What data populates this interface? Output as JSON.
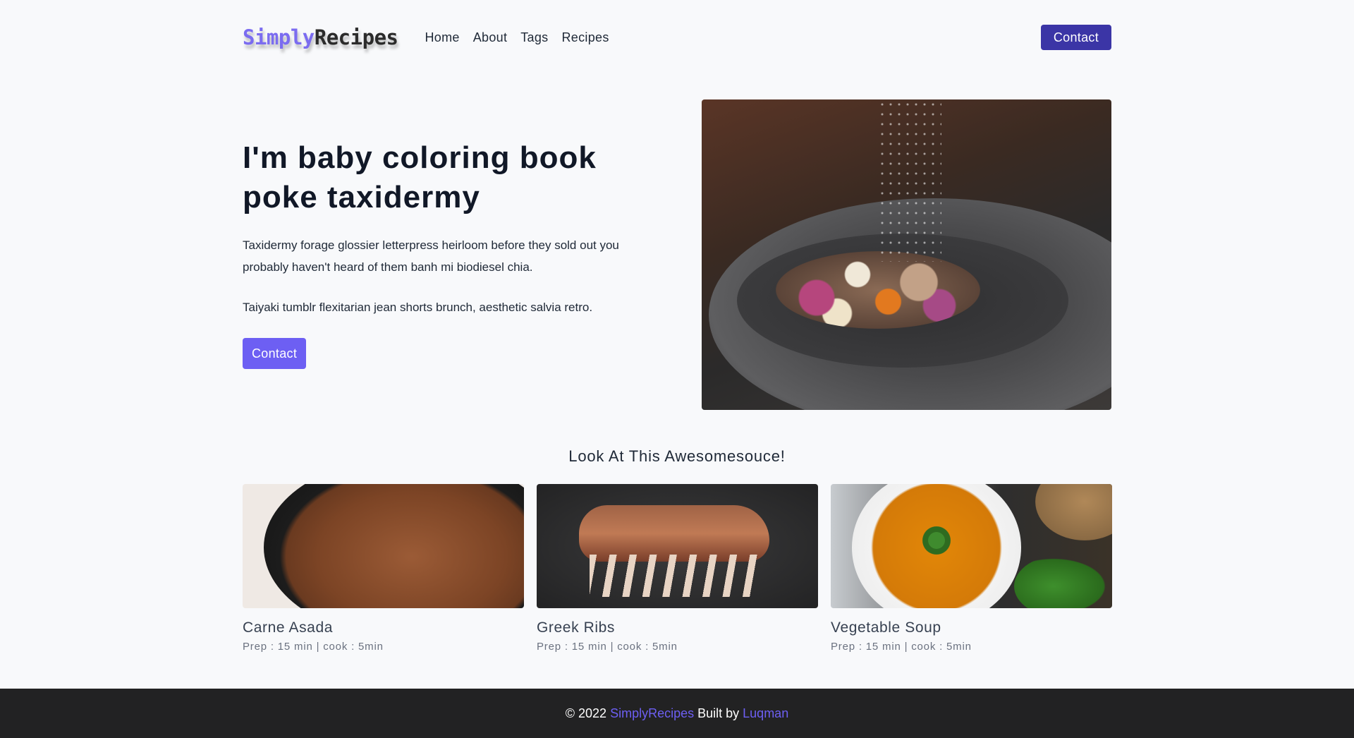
{
  "nav": {
    "logo_part1": "Simply",
    "logo_part2": "Recipes",
    "links": [
      "Home",
      "About",
      "Tags",
      "Recipes"
    ],
    "contact_label": "Contact"
  },
  "hero": {
    "title_line1": "I'm baby coloring book",
    "title_line2": "poke taxidermy",
    "paragraph1": "Taxidermy forage glossier letterpress heirloom before they sold out you probably haven't heard of them banh mi biodiesel chia.",
    "paragraph2": "Taiyaki tumblr flexitarian jean shorts brunch, aesthetic salvia retro.",
    "button_label": "Contact"
  },
  "featured": {
    "title": "Look At This Awesomesouce!",
    "recipes": [
      {
        "name": "Carne Asada",
        "meta": "Prep : 15 min | cook : 5min"
      },
      {
        "name": "Greek Ribs",
        "meta": "Prep : 15 min | cook : 5min"
      },
      {
        "name": "Vegetable Soup",
        "meta": "Prep : 15 min | cook : 5min"
      }
    ]
  },
  "footer": {
    "copyright": "© 2022 ",
    "brand": "SimplyRecipes",
    "built_by": " Built by ",
    "author": "Luqman"
  },
  "colors": {
    "accent": "#6d5ff3",
    "nav_contact_bg": "#3b35a6",
    "footer_bg": "#222223",
    "page_bg": "#f8f9fb"
  }
}
